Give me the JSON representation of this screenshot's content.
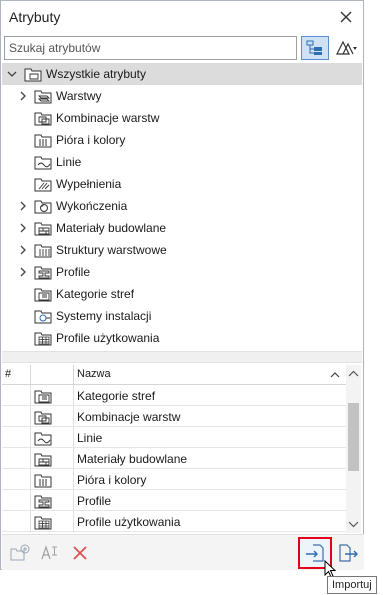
{
  "window": {
    "title": "Atrybuty"
  },
  "search": {
    "placeholder": "Szukaj atrybutów",
    "value": ""
  },
  "tree": {
    "root": {
      "label": "Wszystkie atrybuty",
      "icon": "folder-all-icon",
      "expanded": true
    },
    "items": [
      {
        "label": "Warstwy",
        "icon": "layers-icon",
        "expandable": true
      },
      {
        "label": "Kombinacje warstw",
        "icon": "layer-combinations-icon",
        "expandable": false
      },
      {
        "label": "Pióra i kolory",
        "icon": "pens-colors-icon",
        "expandable": false
      },
      {
        "label": "Linie",
        "icon": "line-types-icon",
        "expandable": false
      },
      {
        "label": "Wypełnienia",
        "icon": "fills-icon",
        "expandable": false
      },
      {
        "label": "Wykończenia",
        "icon": "surfaces-icon",
        "expandable": true
      },
      {
        "label": "Materiały budowlane",
        "icon": "building-materials-icon",
        "expandable": true
      },
      {
        "label": "Struktury warstwowe",
        "icon": "composites-icon",
        "expandable": true
      },
      {
        "label": "Profile",
        "icon": "profiles-icon",
        "expandable": true
      },
      {
        "label": "Kategorie stref",
        "icon": "zone-categories-icon",
        "expandable": false
      },
      {
        "label": "Systemy instalacji",
        "icon": "mep-systems-icon",
        "expandable": false
      },
      {
        "label": "Profile użytkowania",
        "icon": "operation-profiles-icon",
        "expandable": false
      }
    ]
  },
  "table": {
    "columns": {
      "number": "#",
      "name": "Nazwa"
    },
    "rows": [
      {
        "icon": "zone-categories-icon",
        "name": "Kategorie stref"
      },
      {
        "icon": "layer-combinations-icon",
        "name": "Kombinacje warstw"
      },
      {
        "icon": "line-types-icon",
        "name": "Linie"
      },
      {
        "icon": "building-materials-icon",
        "name": "Materiały budowlane"
      },
      {
        "icon": "pens-colors-icon",
        "name": "Pióra i kolory"
      },
      {
        "icon": "profiles-icon",
        "name": "Profile"
      },
      {
        "icon": "operation-profiles-icon",
        "name": "Profile użytkowania"
      }
    ]
  },
  "toolbar": {
    "new_folder": "new-folder-icon",
    "rename": "AI",
    "delete": "delete-icon",
    "import": "import-icon",
    "export": "export-icon"
  },
  "tooltip": {
    "text": "Importuj"
  },
  "colors": {
    "accent": "#2f6db5",
    "highlight_border": "#e2001a",
    "root_row": "#dcdcdc",
    "delete_red": "#e05050"
  }
}
